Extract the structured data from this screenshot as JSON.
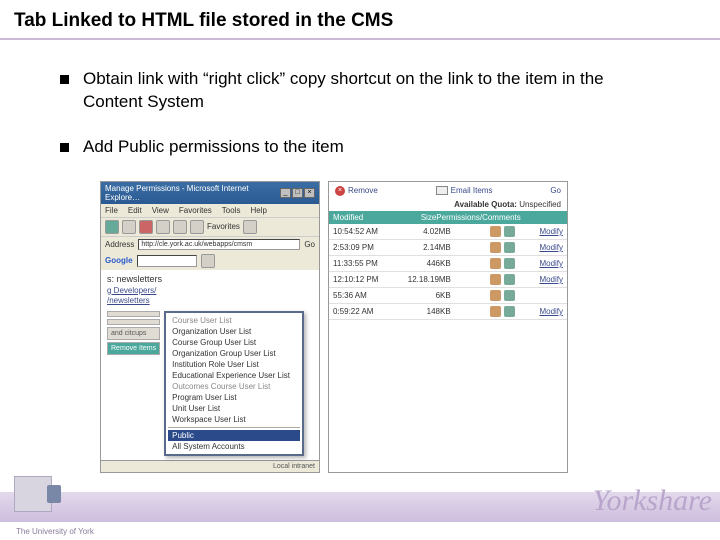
{
  "title": "Tab Linked to HTML file stored in the CMS",
  "bullets": [
    "Obtain link with “right click” copy shortcut on the link to the item in the Content System",
    "Add Public permissions to the item"
  ],
  "browser": {
    "title": "Manage Permissions - Microsoft Internet Explore…",
    "menus": [
      "File",
      "Edit",
      "View",
      "Favorites",
      "Tools",
      "Help"
    ],
    "toolbar": {
      "favorites": "Favorites"
    },
    "address_label": "Address",
    "address": "http://cle.york.ac.uk/webapps/cmsm",
    "google_label": "Google",
    "go": "Go"
  },
  "page": {
    "section": "s: newsletters",
    "links": [
      "g Developers/",
      "/newsletters"
    ],
    "side_tabs": [
      "",
      "",
      "and citcups",
      "Remove Items"
    ],
    "dropdown": [
      "Course User List",
      "Organization User List",
      "Course Group User List",
      "Organization Group User List",
      "Institution Role User List",
      "Educational Experience User List",
      "Outcomes Course User List",
      "Program User List",
      "Unit User List",
      "Workspace User List",
      "Public",
      "All System Accounts"
    ],
    "dropdown_selected": "Public",
    "status": {
      "left": "",
      "right": "Local intranet"
    }
  },
  "right_panel": {
    "remove": "Remove",
    "email": "Email Items",
    "quota_label": "Available Quota:",
    "quota_value": "Unspecified",
    "headers": {
      "time": "Modified",
      "size": "Size",
      "perm": "Permissions/Comments",
      "act": ""
    },
    "rows": [
      {
        "time": "10:54:52 AM",
        "size": "4.02MB",
        "act": "Modify"
      },
      {
        "time": "2:53:09 PM",
        "size": "2.14MB",
        "act": "Modify"
      },
      {
        "time": "11:33:55 PM",
        "size": "446KB",
        "act": "Modify"
      },
      {
        "time": "12:10:12 PM",
        "size": "12.18.19MB",
        "act": "Modify"
      },
      {
        "time": "55:36 AM",
        "size": "6KB",
        "act": ""
      },
      {
        "time": "0:59:22 AM",
        "size": "148KB",
        "act": "Modify"
      }
    ],
    "go": "Go"
  },
  "footer": {
    "org": "The University of York",
    "brand": "Yorkshare"
  }
}
